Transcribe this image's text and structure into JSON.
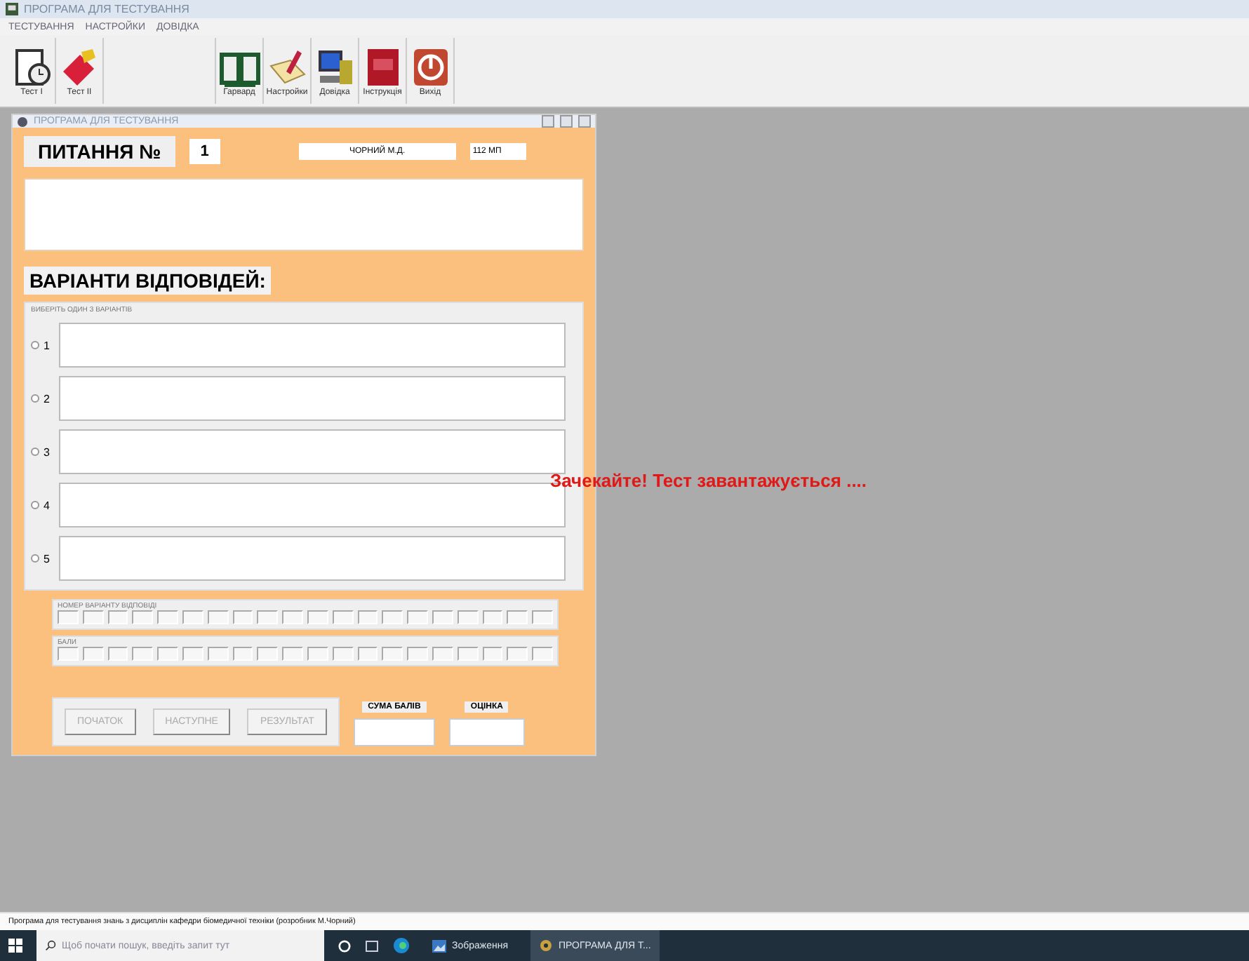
{
  "window": {
    "title": "ПРОГРАМА ДЛЯ ТЕСТУВАННЯ"
  },
  "menu": [
    "ТЕСТУВАННЯ",
    "НАСТРОЙКИ",
    "ДОВІДКА"
  ],
  "toolbar": [
    {
      "label": "Тест I",
      "kind": "clock"
    },
    {
      "label": "Тест II",
      "kind": "eraser"
    },
    {
      "kind": "blank"
    },
    {
      "label": "Гарвард",
      "kind": "book"
    },
    {
      "label": "Настройки",
      "kind": "pen"
    },
    {
      "label": "Довідка",
      "kind": "computer"
    },
    {
      "label": "Інструкція",
      "kind": "manual"
    },
    {
      "label": "Вихід",
      "kind": "power"
    }
  ],
  "child_window": {
    "title": "ПРОГРАМА ДЛЯ ТЕСТУВАННЯ",
    "question_label": "ПИТАННЯ №",
    "question_number": "1",
    "author": "ЧОРНИЙ М.Д.",
    "group": "112 МП",
    "answers_heading": "ВАРІАНТИ ВІДПОВІДЕЙ:",
    "answers_group": "ВИБЕРІТЬ ОДИН З ВАРІАНТІВ",
    "answers": [
      {
        "label": "1",
        "selected": false
      },
      {
        "label": "2",
        "selected": false
      },
      {
        "label": "3",
        "selected": false
      },
      {
        "label": "4",
        "selected": false
      },
      {
        "label": "5",
        "selected": false
      }
    ],
    "tallies": [
      {
        "title": "НОМЕР ВАРІАНТУ ВІДПОВІДІ",
        "boxes": [
          {
            "checked": false
          },
          {
            "checked": false
          },
          {
            "checked": false
          },
          {
            "checked": false
          },
          {
            "checked": false
          },
          {
            "checked": false
          },
          {
            "checked": false
          },
          {
            "checked": false
          },
          {
            "checked": false
          },
          {
            "checked": false
          },
          {
            "checked": false
          },
          {
            "checked": false
          },
          {
            "checked": false
          },
          {
            "checked": false
          },
          {
            "checked": false
          },
          {
            "checked": false
          },
          {
            "checked": false
          },
          {
            "checked": false
          },
          {
            "checked": false
          },
          {
            "checked": false
          }
        ]
      },
      {
        "title": "БАЛИ",
        "boxes": [
          {
            "checked": false
          },
          {
            "checked": false
          },
          {
            "checked": false
          },
          {
            "checked": false
          },
          {
            "checked": false
          },
          {
            "checked": false
          },
          {
            "checked": false
          },
          {
            "checked": false
          },
          {
            "checked": false
          },
          {
            "checked": false
          },
          {
            "checked": false
          },
          {
            "checked": false
          },
          {
            "checked": false
          },
          {
            "checked": false
          },
          {
            "checked": false
          },
          {
            "checked": false
          },
          {
            "checked": false
          },
          {
            "checked": false
          },
          {
            "checked": false
          },
          {
            "checked": false
          }
        ]
      }
    ],
    "buttons": [
      {
        "label": "ПОЧАТОК",
        "disabled": true
      },
      {
        "label": "НАСТУПНЕ",
        "disabled": true
      },
      {
        "label": "РЕЗУЛЬТАТ",
        "disabled": true
      }
    ],
    "score_label": "СУМА БАЛІВ",
    "grade_label": "ОЦІНКА"
  },
  "message": "Зачекайте! Тест завантажується ....",
  "status_bar": "Програма для тестування знань з дисциплін кафедри біомедичної техніки (розробник М.Чорний)",
  "taskbar": {
    "search": {
      "placeholder": "Щоб почати пошук, введіть запит тут"
    },
    "apps": [
      {
        "label": "Зображення",
        "kind": "photos"
      },
      {
        "label": "ПРОГРАМА ДЛЯ Т...",
        "kind": "gear"
      }
    ]
  }
}
